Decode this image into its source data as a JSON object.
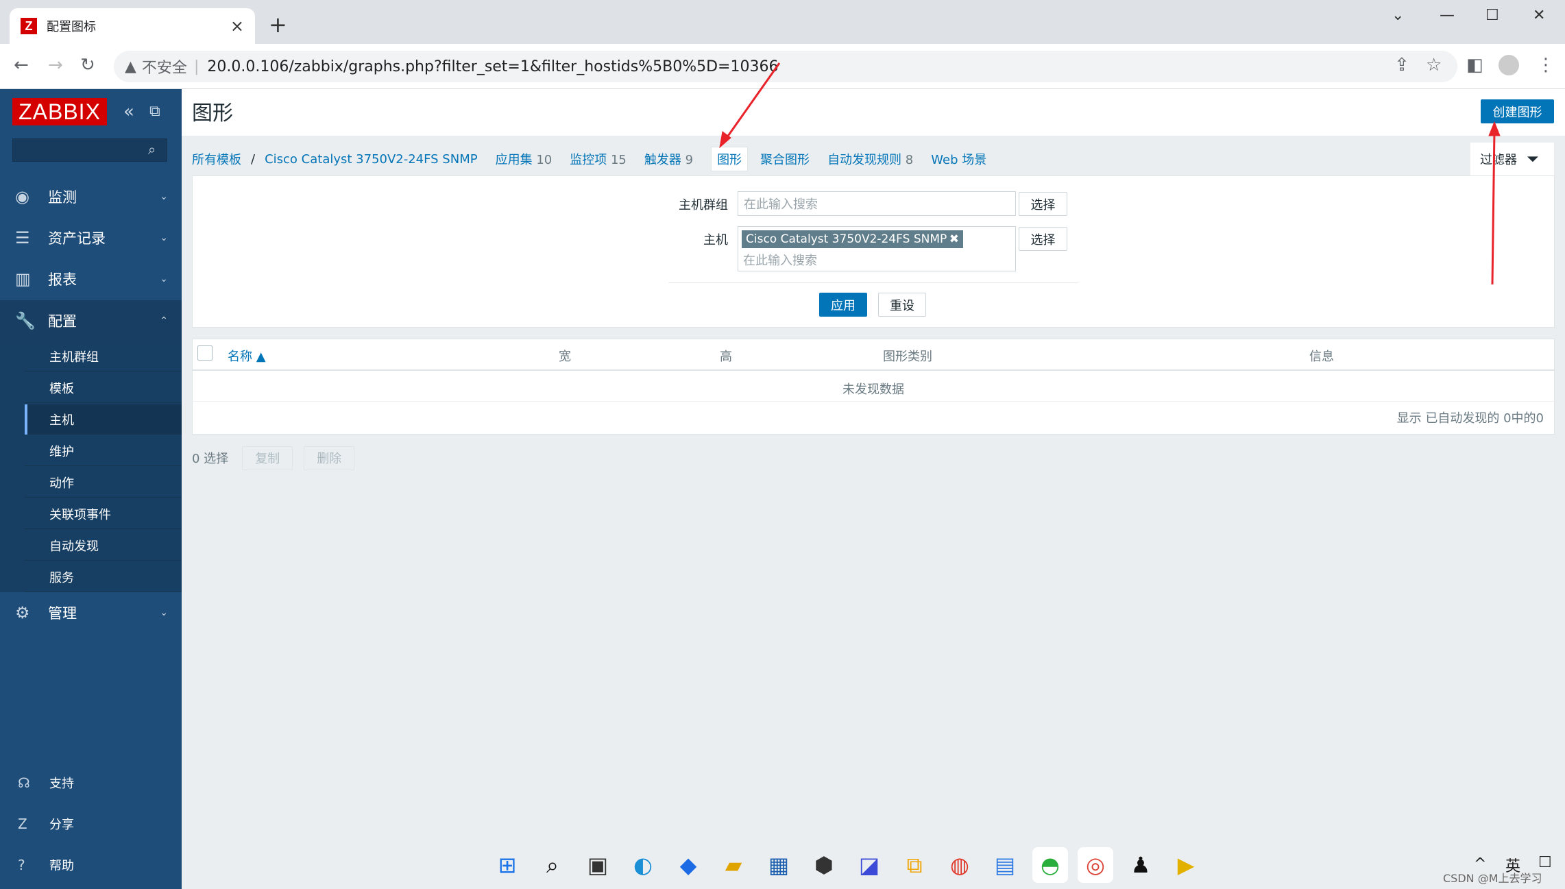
{
  "browser": {
    "tab_title": "配置图标",
    "new_tab": "+",
    "insecure_label": "不安全",
    "address_separator": "|",
    "url": "20.0.0.106/zabbix/graphs.php?filter_set=1&filter_hostids%5B0%5D=10366"
  },
  "sidebar": {
    "logo": "ZABBIX",
    "menu": [
      {
        "label": "监测",
        "icon": "eye-icon"
      },
      {
        "label": "资产记录",
        "icon": "list-icon"
      },
      {
        "label": "报表",
        "icon": "bar-chart-icon"
      },
      {
        "label": "配置",
        "icon": "wrench-icon"
      },
      {
        "label": "管理",
        "icon": "gear-icon"
      }
    ],
    "submenu": [
      "主机群组",
      "模板",
      "主机",
      "维护",
      "动作",
      "关联项事件",
      "自动发现",
      "服务"
    ],
    "active_sub": "主机",
    "bottom": [
      {
        "label": "支持",
        "icon": "headset-icon"
      },
      {
        "label": "分享",
        "icon": "zabbix-share-icon"
      },
      {
        "label": "帮助",
        "icon": "help-icon"
      }
    ]
  },
  "page": {
    "title": "图形",
    "create_button": "创建图形",
    "breadcrumbs": {
      "all_templates": "所有模板",
      "sep": "/",
      "host": "Cisco Catalyst 3750V2-24FS SNMP"
    },
    "tabs": [
      {
        "label": "应用集",
        "count": "10"
      },
      {
        "label": "监控项",
        "count": "15"
      },
      {
        "label": "触发器",
        "count": "9"
      },
      {
        "label": "图形",
        "count": ""
      },
      {
        "label": "聚合图形",
        "count": ""
      },
      {
        "label": "自动发现规则",
        "count": "8"
      },
      {
        "label": "Web 场景",
        "count": ""
      }
    ],
    "filter_tab": "过滤器",
    "filter": {
      "hostgroup_label": "主机群组",
      "host_label": "主机",
      "placeholder": "在此输入搜索",
      "select_button": "选择",
      "host_tag": "Cisco Catalyst 3750V2-24FS SNMP",
      "apply": "应用",
      "reset": "重设"
    },
    "table": {
      "columns": [
        "名称 ▲",
        "宽",
        "高",
        "图形类别",
        "信息"
      ],
      "empty": "未发现数据",
      "paging": "显示 已自动发现的 0中的0"
    },
    "footer": {
      "selected": "0 选择",
      "copy": "复制",
      "delete": "删除"
    }
  },
  "watermark": "CSDN @M上去学习",
  "colors": {
    "sidebar": "#1f4d79",
    "accent": "#0275b8",
    "logo": "#d40000",
    "annotation": "#e8232a"
  }
}
